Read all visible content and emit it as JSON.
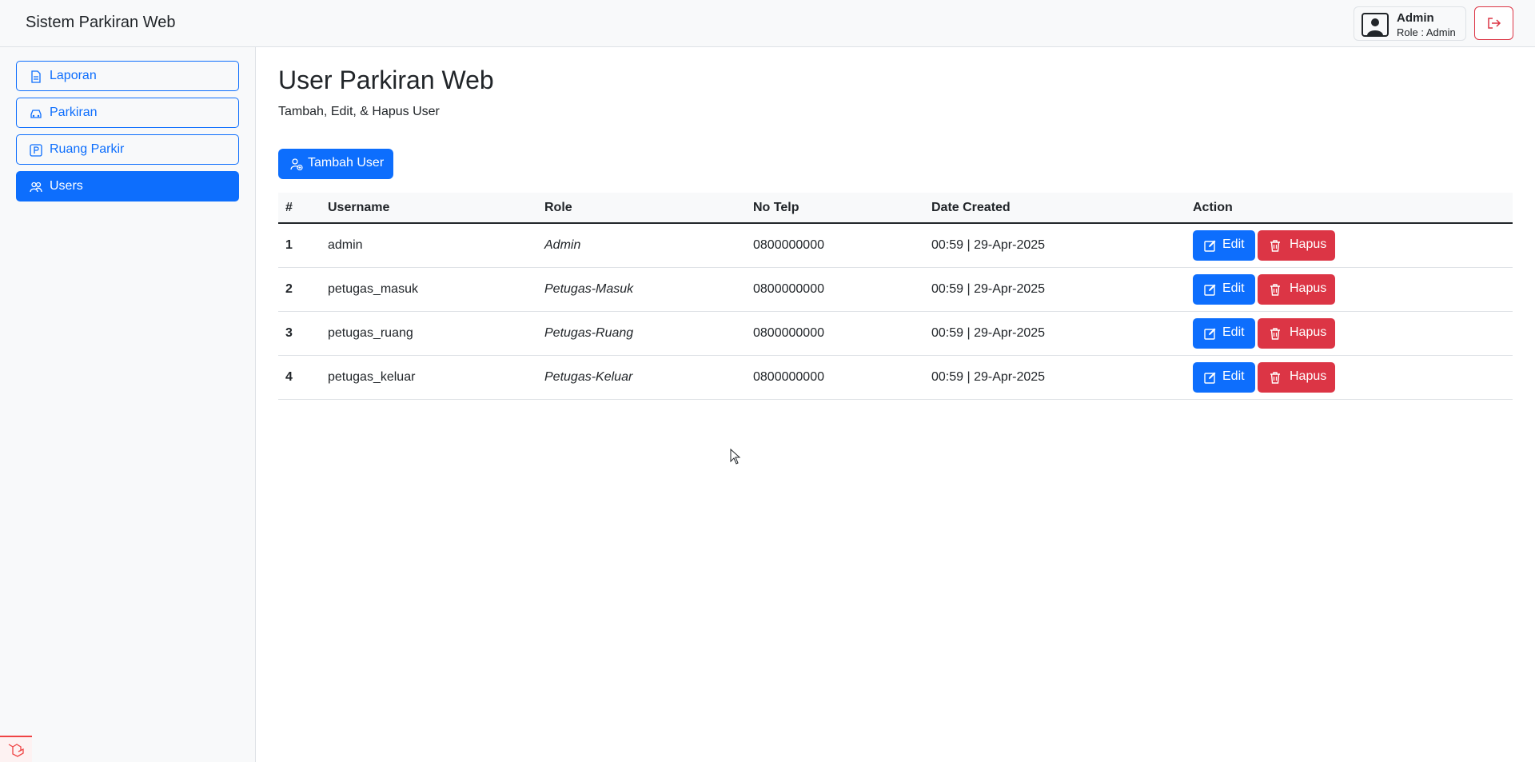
{
  "navbar": {
    "brand": "Sistem Parkiran Web",
    "user_name": "Admin",
    "user_role": "Role : Admin"
  },
  "sidebar": {
    "items": [
      {
        "label": "Laporan",
        "icon": "file-icon"
      },
      {
        "label": "Parkiran",
        "icon": "car-icon"
      },
      {
        "label": "Ruang Parkir",
        "icon": "parking-icon"
      },
      {
        "label": "Users",
        "icon": "users-icon",
        "active": true
      }
    ]
  },
  "main": {
    "title": "User Parkiran Web",
    "subtitle": "Tambah, Edit, & Hapus User",
    "add_button": "Tambah User"
  },
  "table": {
    "headers": [
      "#",
      "Username",
      "Role",
      "No Telp",
      "Date Created",
      "Action"
    ],
    "rows": [
      {
        "no": "1",
        "username": "admin",
        "role": "Admin",
        "phone": "0800000000",
        "created": "00:59 | 29-Apr-2025"
      },
      {
        "no": "2",
        "username": "petugas_masuk",
        "role": "Petugas-Masuk",
        "phone": "0800000000",
        "created": "00:59 | 29-Apr-2025"
      },
      {
        "no": "3",
        "username": "petugas_ruang",
        "role": "Petugas-Ruang",
        "phone": "0800000000",
        "created": "00:59 | 29-Apr-2025"
      },
      {
        "no": "4",
        "username": "petugas_keluar",
        "role": "Petugas-Keluar",
        "phone": "0800000000",
        "created": "00:59 | 29-Apr-2025"
      }
    ],
    "edit_label": "Edit",
    "delete_label": "Hapus"
  },
  "colors": {
    "primary": "#0d6efd",
    "danger": "#dc3545",
    "sidebar_bg": "#f8f9fa"
  }
}
